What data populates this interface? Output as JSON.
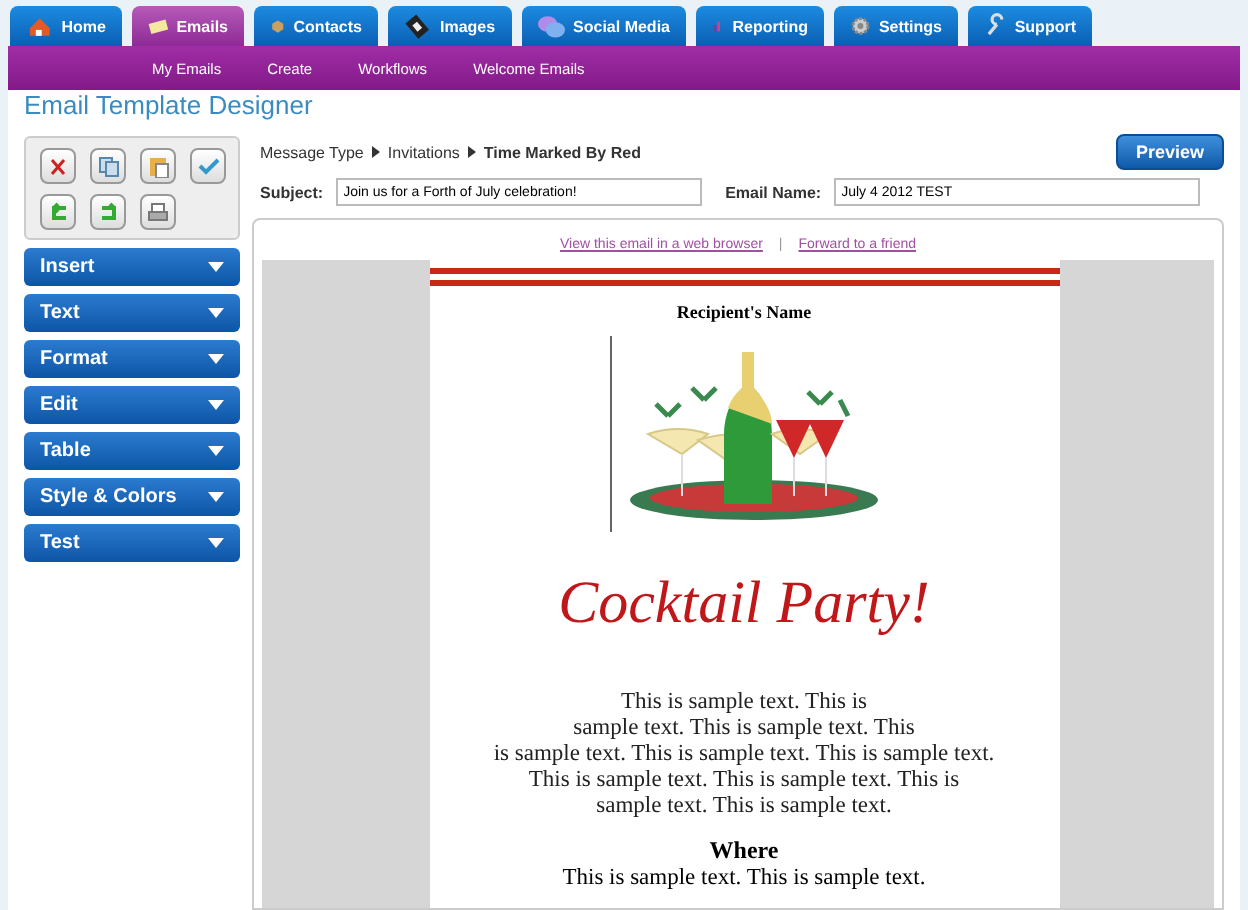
{
  "tabs": [
    {
      "label": "Home",
      "selected": false
    },
    {
      "label": "Emails",
      "selected": true
    },
    {
      "label": "Contacts",
      "selected": false
    },
    {
      "label": "Images",
      "selected": false
    },
    {
      "label": "Social Media",
      "selected": false
    },
    {
      "label": "Reporting",
      "selected": false
    },
    {
      "label": "Settings",
      "selected": false
    },
    {
      "label": "Support",
      "selected": false
    }
  ],
  "subnav": [
    "My Emails",
    "Create",
    "Workflows",
    "Welcome Emails"
  ],
  "page_title": "Email Template Designer",
  "toolbar": [
    {
      "kind": "cut"
    },
    {
      "kind": "copy"
    },
    {
      "kind": "paste"
    },
    {
      "kind": "check"
    },
    {
      "kind": "undo"
    },
    {
      "kind": "redo"
    },
    {
      "kind": "print"
    }
  ],
  "menus": [
    "Insert",
    "Text",
    "Format",
    "Edit",
    "Table",
    "Style & Colors",
    "Test"
  ],
  "breadcrumb": [
    "Message Type",
    "Invitations",
    "Time Marked By Red"
  ],
  "preview_button": "Preview",
  "subject": {
    "label": "Subject:",
    "value": "Join us for a Forth of July celebration!"
  },
  "email_name": {
    "label": "Email Name:",
    "value": "July 4 2012 TEST"
  },
  "links": [
    "View this email in a web browser",
    "|",
    "Forward to a friend"
  ],
  "email": {
    "recipient": "Recipient's Name",
    "headline": "Cocktail Party!",
    "body_lines": [
      "This is sample text. This is",
      "sample text. This is sample text. This",
      "is sample text. This is sample text. This is sample text.",
      "This is sample text. This is sample text. This is",
      "sample text. This is sample text."
    ],
    "where_heading": "Where",
    "where_text": "This is sample text. This is sample text."
  }
}
